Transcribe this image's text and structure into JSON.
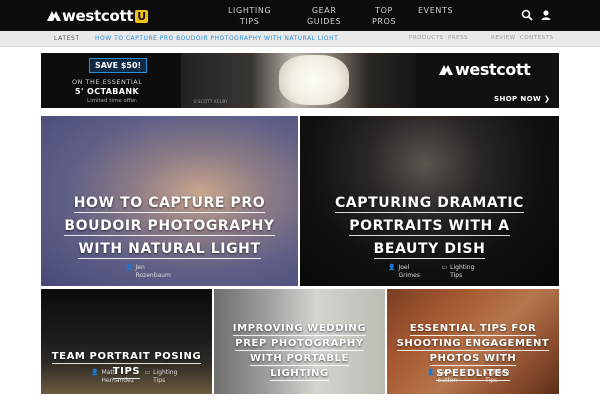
{
  "header": {
    "logo_text": "westcott",
    "logo_badge": "U",
    "nav": [
      {
        "label": "LIGHTING\nTIPS"
      },
      {
        "label": "GEAR\nGUIDES"
      },
      {
        "label": "TOP\nPROS"
      },
      {
        "label": "EVENTS"
      }
    ],
    "search_icon": "search-icon",
    "user_icon": "user-icon"
  },
  "ticker": {
    "label": "LATEST",
    "headline": "HOW TO CAPTURE PRO BOUDOIR PHOTOGRAPHY WITH NATURAL LIGHT",
    "links": [
      "PRODUCTS",
      "PRESS",
      "REVIEW",
      "CONTESTS"
    ]
  },
  "ad": {
    "badge": "SAVE $50!",
    "line1": "ON THE ESSENTIAL",
    "line2": "5' OCTABANK",
    "line3": "Limited time offer.",
    "credit": "©SCOTT KELBY",
    "brand": "westcott",
    "cta": "SHOP NOW ❯"
  },
  "articles": [
    {
      "title": "HOW TO CAPTURE PRO BOUDOIR PHOTOGRAPHY WITH NATURAL LIGHT",
      "author": "Jen Rozenbaum",
      "category": ""
    },
    {
      "title": "CAPTURING DRAMATIC PORTRAITS WITH A BEAUTY DISH",
      "author": "Joel Grimes",
      "category": "Lighting Tips"
    },
    {
      "title": "TEAM PORTRAIT POSING TIPS",
      "author": "Matt Hernandez",
      "category": "Lighting Tips"
    },
    {
      "title": "IMPROVING WEDDING PREP PHOTOGRAPHY WITH PORTABLE LIGHTING",
      "author": "",
      "category": ""
    },
    {
      "title": "ESSENTIAL TIPS FOR SHOOTING ENGAGEMENT PHOTOS WITH SPEEDLITES",
      "author": "Zach Sutton",
      "category": "Lighting Tips"
    }
  ],
  "colors": {
    "header_bg": "#0c0c0c",
    "accent_blue": "#2b8ed8",
    "badge_yellow": "#f3c317"
  }
}
